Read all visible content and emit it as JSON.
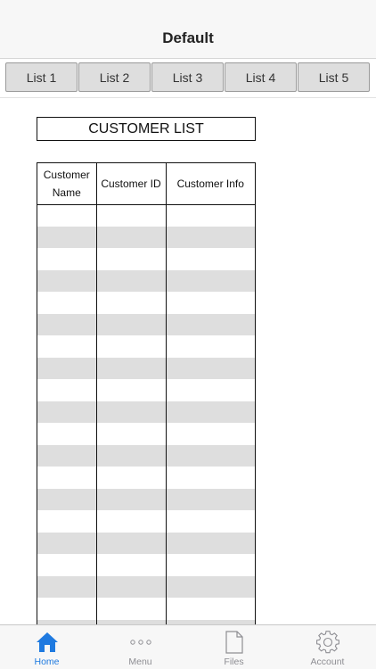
{
  "nav": {
    "title": "Default"
  },
  "segments": [
    "List 1",
    "List 2",
    "List 3",
    "List 4",
    "List 5"
  ],
  "main": {
    "title": "CUSTOMER LIST",
    "columns": [
      "Customer Name",
      "Customer ID",
      "Customer Info"
    ]
  },
  "tabbar": {
    "tabs": [
      {
        "label": "Home",
        "icon": "home-icon",
        "active": true
      },
      {
        "label": "Menu",
        "icon": "more-dots-icon",
        "active": false
      },
      {
        "label": "Files",
        "icon": "document-icon",
        "active": false
      },
      {
        "label": "Account",
        "icon": "gear-icon",
        "active": false
      }
    ]
  },
  "colors": {
    "accent": "#1f7ae0",
    "row_alt": "#dedede",
    "inactive": "#8e8e93"
  }
}
